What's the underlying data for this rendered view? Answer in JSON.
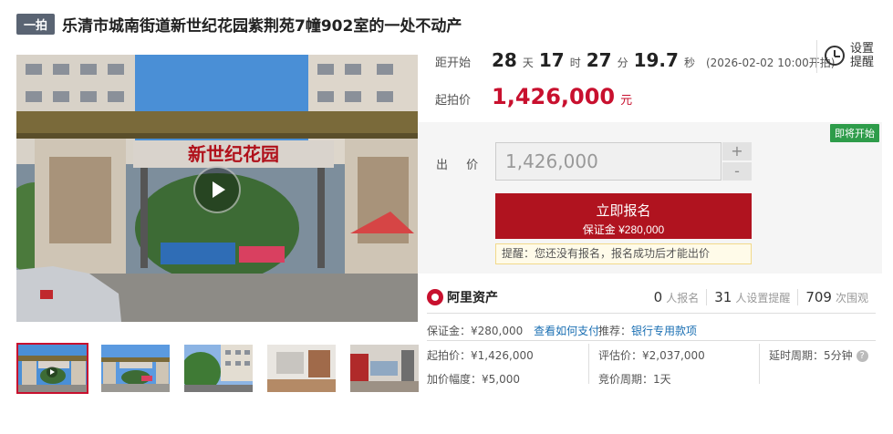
{
  "header": {
    "round_badge": "一拍",
    "title": "乐清市城南街道新世纪花园紫荆苑7幢902室的一处不动产"
  },
  "media": {
    "gate_sign": "新世纪花园",
    "play_icon": "play-icon",
    "thumbnails": [
      {
        "kind": "gate",
        "active": true
      },
      {
        "kind": "gate-wide",
        "active": false
      },
      {
        "kind": "buildings",
        "active": false
      },
      {
        "kind": "interior",
        "active": false
      },
      {
        "kind": "kitchen",
        "active": false
      }
    ]
  },
  "countdown": {
    "label": "距开始",
    "days": "28",
    "days_unit": "天",
    "hours": "17",
    "hours_unit": "时",
    "minutes": "27",
    "minutes_unit": "分",
    "seconds": "19.7",
    "seconds_unit": "秒",
    "start_note": "(2026-02-02 10:00开拍)"
  },
  "reminder": {
    "icon": "alarm-clock-icon",
    "label": "设置提醒"
  },
  "start_price": {
    "label": "起拍价",
    "value": "1,426,000",
    "unit": "元"
  },
  "bid": {
    "status_tag": "即将开始",
    "label": "出 价",
    "input_value": "1,426,000",
    "plus": "+",
    "minus": "-",
    "register_button": "立即报名",
    "deposit_line": "保证金 ¥280,000",
    "notice": "提醒：您还没有报名，报名成功后才能出价"
  },
  "stats": {
    "brand": "阿里资产",
    "registered_count": "0",
    "registered_label": "人报名",
    "reminder_count": "31",
    "reminder_label": "人设置提醒",
    "views_count": "709",
    "views_label": "次围观"
  },
  "details": {
    "deposit_label": "保证金：",
    "deposit_value": "¥280,000",
    "how_to_pay": "查看如何支付",
    "recommend_label": "推荐：",
    "recommend_link": "银行专用款项",
    "start_price_label": "起拍价：",
    "start_price_value": "¥1,426,000",
    "appraisal_label": "评估价：",
    "appraisal_value": "¥2,037,000",
    "delay_label": "延时周期：",
    "delay_value": "5分钟",
    "increment_label": "加价幅度：",
    "increment_value": "¥5,000",
    "bid_period_label": "竞价周期：",
    "bid_period_value": "1天",
    "help_icon": "?"
  }
}
